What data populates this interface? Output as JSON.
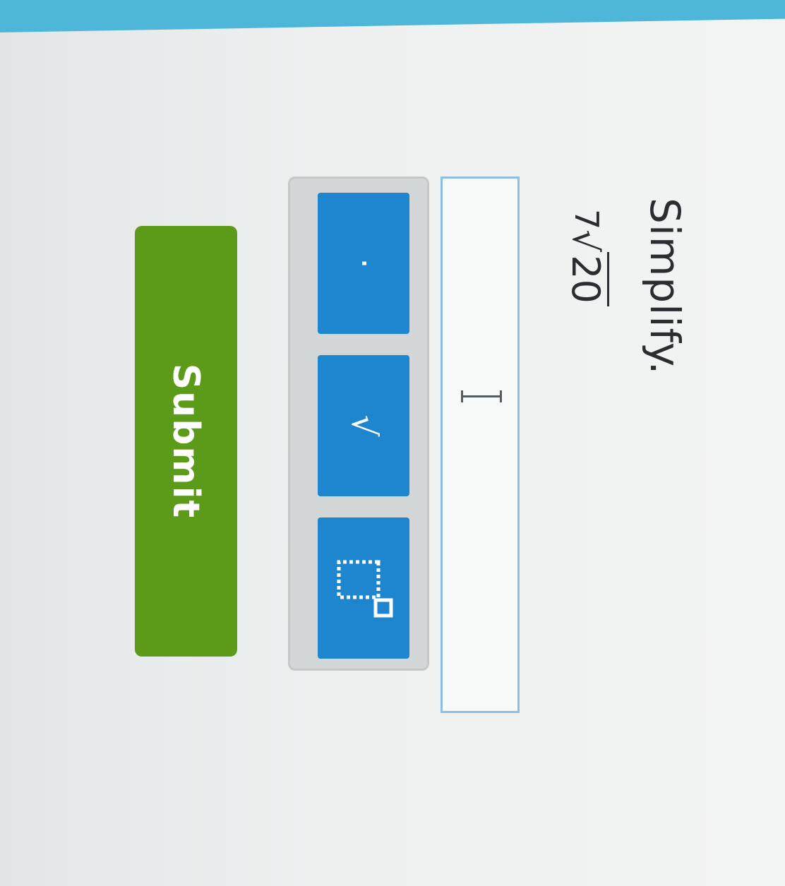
{
  "question": {
    "prompt": "Simplify.",
    "coefficient": "7",
    "radical_symbol": "√",
    "radicand": "20"
  },
  "answer": {
    "value": "",
    "placeholder": ""
  },
  "keypad": {
    "keys": [
      {
        "label": "·",
        "icon": "multiplication-dot-icon"
      },
      {
        "label": "√",
        "icon": "square-root-icon"
      },
      {
        "label": "",
        "icon": "superscript-exponent-icon"
      }
    ]
  },
  "actions": {
    "submit_label": "Submit"
  },
  "colors": {
    "header": "#4eb6d8",
    "key": "#1e86cf",
    "submit": "#5c9a1a",
    "input_border": "#8fbfe0"
  }
}
